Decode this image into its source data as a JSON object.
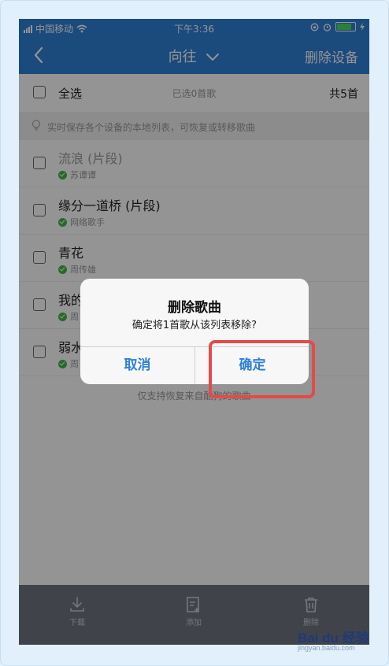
{
  "status_bar": {
    "carrier": "中国移动",
    "time": "下午3:36"
  },
  "nav": {
    "title": "向往",
    "action": "删除设备"
  },
  "select_bar": {
    "select_all": "全选",
    "selected_text": "已选0首歌",
    "total": "共5首"
  },
  "tip": "实时保存各个设备的本地列表，可恢复或转移歌曲",
  "songs": [
    {
      "title": "流浪 (片段)",
      "artist": "苏谭谭"
    },
    {
      "title": "缘分一道桥 (片段)",
      "artist": "网络歌手"
    },
    {
      "title": "青花",
      "artist": "周传雄"
    },
    {
      "title": "我的",
      "artist": "周"
    },
    {
      "title": "弱水",
      "artist": "周"
    }
  ],
  "footnote": "仅支持恢复来自酷狗的歌曲",
  "toolbar": {
    "download": "下载",
    "add": "添加",
    "delete": "删除"
  },
  "dialog": {
    "title": "删除歌曲",
    "message": "确定将1首歌从该列表移除?",
    "cancel": "取消",
    "confirm": "确定"
  },
  "watermark": {
    "logo": "Bai du 经验",
    "sub": "jingyan.baidu.com"
  },
  "colors": {
    "brand_blue": "#2f80d8",
    "highlight_red": "#e34b4b",
    "ok_green": "#44b549"
  }
}
